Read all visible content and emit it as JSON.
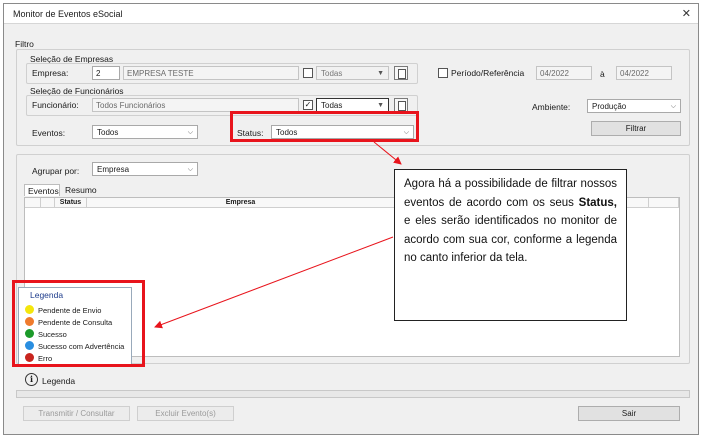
{
  "window": {
    "title": "Monitor de Eventos eSocial",
    "close_glyph": "✕"
  },
  "filtro": {
    "label": "Filtro",
    "empresas": {
      "group_label": "Seleção de Empresas",
      "field_label": "Empresa:",
      "code": "2",
      "name": "EMPRESA TESTE",
      "todas_label": "Todas",
      "todas_checked": false
    },
    "periodo": {
      "checkbox_label": "Período/Referência",
      "checked": false,
      "from": "04/2022",
      "separator": "à",
      "to": "04/2022"
    },
    "funcionarios": {
      "group_label": "Seleção de Funcionários",
      "field_label": "Funcionário:",
      "value": "Todos Funcionários",
      "todas_label": "Todas",
      "todas_checked": true
    },
    "ambiente": {
      "label": "Ambiente:",
      "value": "Produção"
    },
    "eventos": {
      "label": "Eventos:",
      "value": "Todos"
    },
    "status": {
      "label": "Status:",
      "value": "Todos"
    },
    "filtrar_button": "Filtrar"
  },
  "agrupar": {
    "label": "Agrupar por:",
    "value": "Empresa"
  },
  "tabs": [
    "Eventos",
    "Resumo"
  ],
  "grid": {
    "columns": [
      "Status",
      "Empresa"
    ]
  },
  "legend": {
    "title": "Legenda",
    "items": [
      {
        "label": "Pendente de Envio",
        "color": "#f4e60c"
      },
      {
        "label": "Pendente de Consulta",
        "color": "#ef7b2d"
      },
      {
        "label": "Sucesso",
        "color": "#1c9a2a"
      },
      {
        "label": "Sucesso com Advertência",
        "color": "#2a8ee0"
      },
      {
        "label": "Erro",
        "color": "#c8251e"
      }
    ]
  },
  "legend_toggle": {
    "label": "Legenda",
    "icon": "i"
  },
  "callout": {
    "text_before": "Agora há a possibilidade de filtrar nossos eventos de acordo com os seus ",
    "bold": "Status,",
    "text_after": " e eles serão identificados no monitor de acordo com sua cor, conforme a legenda no canto inferior da tela."
  },
  "footer": {
    "transmit_button": "Transmitir / Consultar",
    "excluir_button": "Excluir Evento(s)",
    "sair_button": "Sair"
  },
  "colors": {
    "highlight": "#e8141c",
    "arrow": "#e8141c",
    "legend_title": "#1e3c8c"
  }
}
